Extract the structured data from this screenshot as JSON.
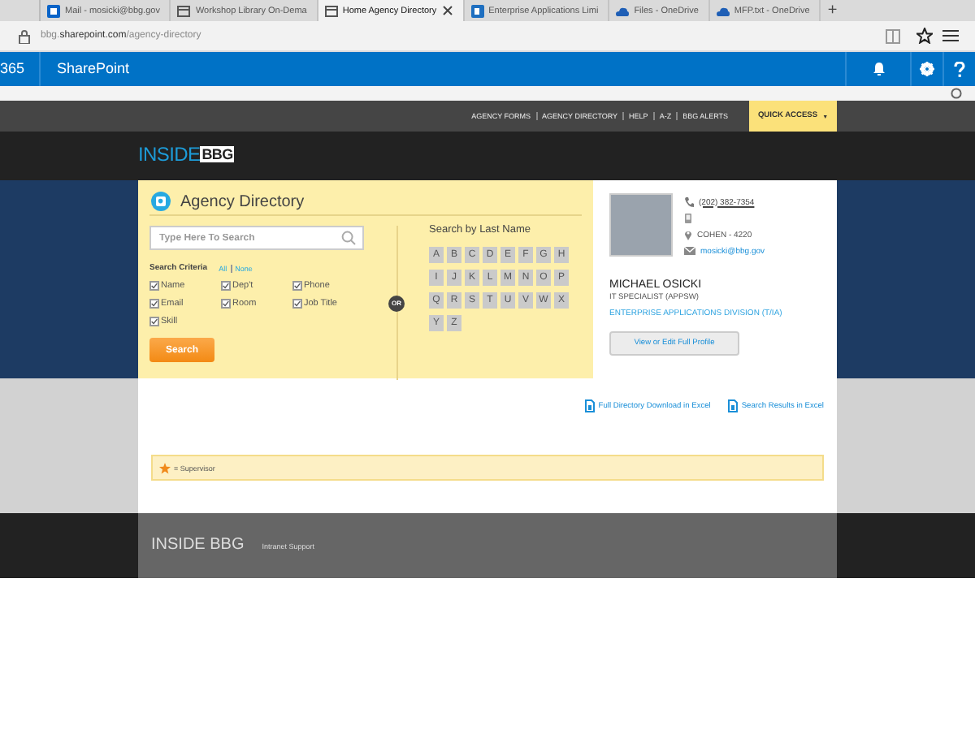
{
  "browser": {
    "tabs": [
      {
        "label": "Mail - mosicki@bbg.gov",
        "selected": false
      },
      {
        "label": "Workshop Library On-Dema",
        "selected": false
      },
      {
        "label": "Home Agency Directory",
        "selected": true
      },
      {
        "label": "Enterprise Applications Limi",
        "selected": false
      },
      {
        "label": "Files - OneDrive",
        "selected": false
      },
      {
        "label": "MFP.txt - OneDrive",
        "selected": false
      }
    ],
    "new_tab": "+",
    "address": "bbg.**sharepoint.com**/agency-directory"
  },
  "suite_bar": {
    "app_number": "365",
    "app_name": "SharePoint"
  },
  "top_nav": {
    "links": [
      "AGENCY FORMS",
      "AGENCY DIRECTORY",
      "HELP",
      "A-Z",
      "BBG ALERTS"
    ],
    "quick_access": "QUICK ACCESS",
    "quick_access_caret": "▼"
  },
  "logo": {
    "first": "INSIDE",
    "second": "BBG"
  },
  "directory": {
    "title": "Agency Directory",
    "search": {
      "placeholder": "Type Here To Search"
    },
    "criteria_label": "Search Criteria",
    "all": "All",
    "none": "None",
    "criteria": [
      {
        "label": "Name",
        "checked": true
      },
      {
        "label": "Dep't",
        "checked": true
      },
      {
        "label": "Phone",
        "checked": true
      },
      {
        "label": "Email",
        "checked": true
      },
      {
        "label": "Room",
        "checked": true
      },
      {
        "label": "Job Title",
        "checked": true
      },
      {
        "label": "Skill",
        "checked": true
      }
    ],
    "search_button": "Search",
    "or": "OR",
    "last_name_title": "Search by Last Name",
    "letters": [
      "A",
      "B",
      "C",
      "D",
      "E",
      "F",
      "G",
      "H",
      "I",
      "J",
      "K",
      "L",
      "M",
      "N",
      "O",
      "P",
      "Q",
      "R",
      "S",
      "T",
      "U",
      "V",
      "W",
      "X",
      "Y",
      "Z"
    ]
  },
  "profile": {
    "phone": "(202) 382-7354",
    "location": "COHEN - 4220",
    "email": "mosicki@bbg.gov",
    "name": "MICHAEL OSICKI",
    "job_title": "IT SPECIALIST (APPSW)",
    "division": "ENTERPRISE APPLICATIONS DIVISION (T/IA)",
    "button": "View or Edit Full Profile"
  },
  "downloads": [
    "Full Directory Download in Excel",
    "Search Results in Excel"
  ],
  "legend": "= Supervisor",
  "footer": {
    "title": "INSIDE BBG",
    "link": "Intranet Support"
  }
}
